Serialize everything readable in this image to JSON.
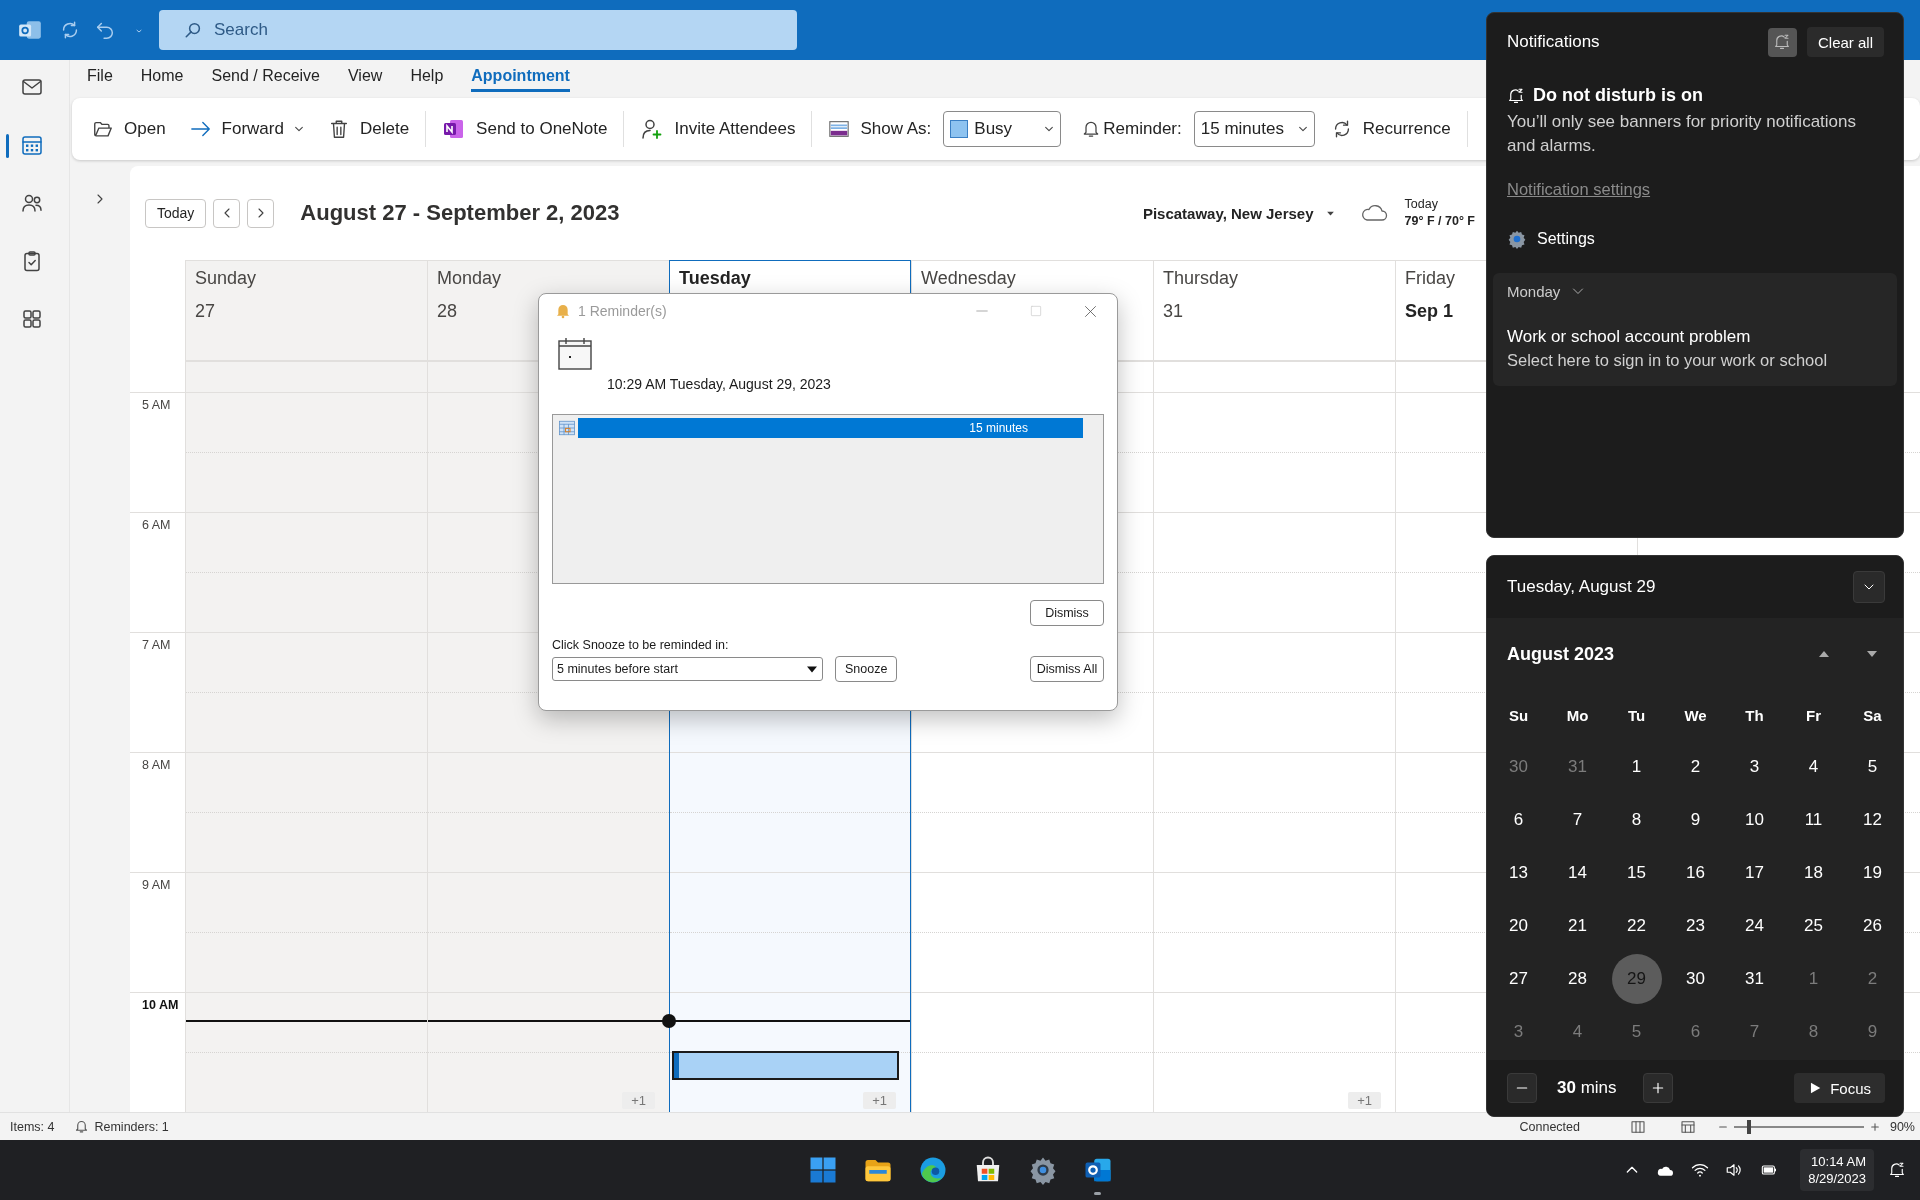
{
  "title_bar": {
    "search": {
      "placeholder": "Search"
    }
  },
  "nav_rail": [
    {
      "kind": "mail",
      "selected": false
    },
    {
      "kind": "calendar",
      "selected": true
    },
    {
      "kind": "people",
      "selected": false
    },
    {
      "kind": "tasks",
      "selected": false
    },
    {
      "kind": "apps",
      "selected": false
    }
  ],
  "menu_tabs": [
    {
      "label": "File",
      "selected": false
    },
    {
      "label": "Home",
      "selected": false
    },
    {
      "label": "Send / Receive",
      "selected": false
    },
    {
      "label": "View",
      "selected": false
    },
    {
      "label": "Help",
      "selected": false
    },
    {
      "label": "Appointment",
      "selected": true
    }
  ],
  "ribbon": {
    "open": "Open",
    "forward": "Forward",
    "delete": "Delete",
    "send_to_onenote": "Send to OneNote",
    "invite_attendees": "Invite Attendees",
    "show_as": {
      "label": "Show As:",
      "value": "Busy"
    },
    "reminder": {
      "label": "Reminder:",
      "value": "15 minutes"
    },
    "recurrence": "Recurrence"
  },
  "calendar": {
    "today_button": "Today",
    "date_range": "August 27 - September 2, 2023",
    "location": "Piscataway, New Jersey",
    "weather": {
      "day": "Today",
      "temperatures": "79° F / 70° F"
    },
    "days": [
      {
        "name": "Sunday",
        "date": "27",
        "past": true,
        "selected": false,
        "date_bold": false,
        "now_line": true,
        "has_event": false
      },
      {
        "name": "Monday",
        "date": "28",
        "past": true,
        "selected": false,
        "date_bold": false,
        "now_line": true,
        "has_event": false,
        "more": "+1"
      },
      {
        "name": "Tuesday",
        "past": false,
        "selected": true,
        "now_line": true,
        "has_event": true,
        "more": "+1"
      },
      {
        "name": "Wednesday",
        "past": false,
        "selected": false,
        "now_line": false,
        "has_event": false
      },
      {
        "name": "Thursday",
        "date": "31",
        "past": false,
        "selected": false,
        "date_bold": false,
        "now_line": false,
        "has_event": false,
        "more": "+1"
      },
      {
        "name": "Friday",
        "date": "Sep 1",
        "past": false,
        "selected": false,
        "date_bold": true,
        "now_line": false,
        "has_event": false
      }
    ],
    "hours": [
      {
        "label": "5 AM",
        "current": false
      },
      {
        "label": "6 AM",
        "current": false
      },
      {
        "label": "7 AM",
        "current": false
      },
      {
        "label": "8 AM",
        "current": false
      },
      {
        "label": "9 AM",
        "current": false
      },
      {
        "label": "10 AM",
        "current": true
      }
    ]
  },
  "status_bar": {
    "items": "Items: 4",
    "reminders": "Reminders: 1",
    "connection": "Connected",
    "zoom": {
      "level": 0.1,
      "reading": "90%"
    }
  },
  "taskbar": {
    "apps": [
      {
        "kind": "start",
        "selected": false
      },
      {
        "kind": "explorer",
        "selected": false
      },
      {
        "kind": "edge",
        "selected": false
      },
      {
        "kind": "store",
        "selected": false
      },
      {
        "kind": "settings",
        "selected": false
      },
      {
        "kind": "outlook",
        "selected": true
      }
    ],
    "time": "10:14 AM",
    "date": "8/29/2023"
  },
  "reminder_dialog": {
    "title": "1 Reminder(s)",
    "due": "10:29 AM Tuesday, August 29, 2023",
    "reminders": [
      {
        "due_in": "15 minutes",
        "selected": true
      }
    ],
    "dismiss": "Dismiss",
    "snooze_label": "Click Snooze to be reminded in:",
    "snooze_choice": "5 minutes before start",
    "snooze": "Snooze",
    "dismiss_all": "Dismiss All"
  },
  "notifications": {
    "title": "Notifications",
    "do_not_disturb_on": true,
    "clear_all": "Clear all",
    "dnd_heading": "Do not disturb is on",
    "dnd_text": "You’ll only see banners for priority notifications and alarms.",
    "settings_link": "Notification settings",
    "settings_app": "Settings",
    "groups": [
      {
        "day": "Monday",
        "items": [
          {
            "title": "Work or school account problem",
            "body": "Select here to sign in to your work or school"
          }
        ]
      }
    ]
  },
  "calendar_flyout": {
    "date": "Tuesday, August 29",
    "month": "August 2023",
    "weekdays": [
      "Su",
      "Mo",
      "Tu",
      "We",
      "Th",
      "Fr",
      "Sa"
    ],
    "weeks": [
      [
        {
          "day": "30",
          "in_month": false,
          "selected": false
        },
        {
          "day": "31",
          "in_month": false,
          "selected": false
        },
        {
          "day": "1",
          "in_month": true,
          "selected": false
        },
        {
          "day": "2",
          "in_month": true,
          "selected": false
        },
        {
          "day": "3",
          "in_month": true,
          "selected": false
        },
        {
          "day": "4",
          "in_month": true,
          "selected": false
        },
        {
          "day": "5",
          "in_month": true,
          "selected": false
        }
      ],
      [
        {
          "day": "6",
          "in_month": true,
          "selected": false
        },
        {
          "day": "7",
          "in_month": true,
          "selected": false
        },
        {
          "day": "8",
          "in_month": true,
          "selected": false
        },
        {
          "day": "9",
          "in_month": true,
          "selected": false
        },
        {
          "day": "10",
          "in_month": true,
          "selected": false
        },
        {
          "day": "11",
          "in_month": true,
          "selected": false
        },
        {
          "day": "12",
          "in_month": true,
          "selected": false
        }
      ],
      [
        {
          "day": "13",
          "in_month": true,
          "selected": false
        },
        {
          "day": "14",
          "in_month": true,
          "selected": false
        },
        {
          "day": "15",
          "in_month": true,
          "selected": false
        },
        {
          "day": "16",
          "in_month": true,
          "selected": false
        },
        {
          "day": "17",
          "in_month": true,
          "selected": false
        },
        {
          "day": "18",
          "in_month": true,
          "selected": false
        },
        {
          "day": "19",
          "in_month": true,
          "selected": false
        }
      ],
      [
        {
          "day": "20",
          "in_month": true,
          "selected": false
        },
        {
          "day": "21",
          "in_month": true,
          "selected": false
        },
        {
          "day": "22",
          "in_month": true,
          "selected": false
        },
        {
          "day": "23",
          "in_month": true,
          "selected": false
        },
        {
          "day": "24",
          "in_month": true,
          "selected": false
        },
        {
          "day": "25",
          "in_month": true,
          "selected": false
        },
        {
          "day": "26",
          "in_month": true,
          "selected": false
        }
      ],
      [
        {
          "day": "27",
          "in_month": true,
          "selected": false
        },
        {
          "day": "28",
          "in_month": true,
          "selected": false
        },
        {
          "day": "29",
          "in_month": true,
          "selected": true
        },
        {
          "day": "30",
          "in_month": true,
          "selected": false
        },
        {
          "day": "31",
          "in_month": true,
          "selected": false
        },
        {
          "day": "1",
          "in_month": false,
          "selected": false
        },
        {
          "day": "2",
          "in_month": false,
          "selected": false
        }
      ],
      [
        {
          "day": "3",
          "in_month": false,
          "selected": false
        },
        {
          "day": "4",
          "in_month": false,
          "selected": false
        },
        {
          "day": "5",
          "in_month": false,
          "selected": false
        },
        {
          "day": "6",
          "in_month": false,
          "selected": false
        },
        {
          "day": "7",
          "in_month": false,
          "selected": false
        },
        {
          "day": "8",
          "in_month": false,
          "selected": false
        },
        {
          "day": "9",
          "in_month": false,
          "selected": false
        }
      ]
    ],
    "focus": {
      "duration": "**30** mins",
      "start": "Focus"
    }
  }
}
